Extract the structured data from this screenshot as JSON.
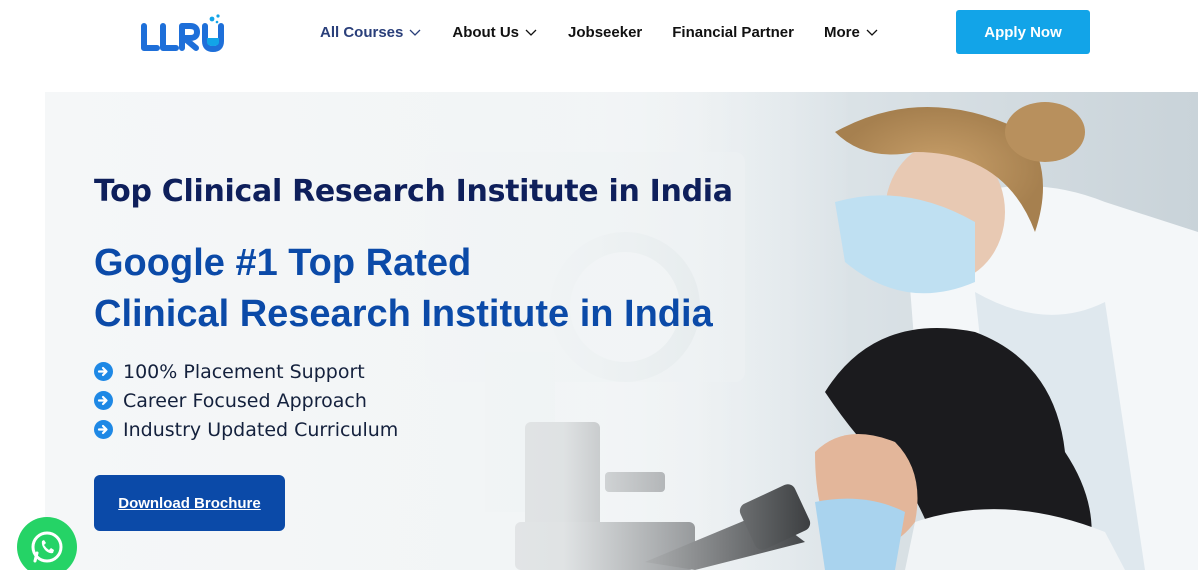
{
  "header": {
    "logo_text": "LLRU",
    "nav": [
      {
        "label": "All Courses",
        "has_dropdown": true,
        "active": true
      },
      {
        "label": "About Us",
        "has_dropdown": true,
        "active": false
      },
      {
        "label": "Jobseeker",
        "has_dropdown": false,
        "active": false
      },
      {
        "label": "Financial Partner",
        "has_dropdown": false,
        "active": false
      },
      {
        "label": "More",
        "has_dropdown": true,
        "active": false
      }
    ],
    "apply_label": "Apply Now"
  },
  "hero": {
    "subtitle": "Top Clinical Research Institute in India",
    "headline_line1": "Google #1 Top Rated",
    "headline_line2": "Clinical Research Institute in India",
    "features": [
      "100% Placement Support",
      "Career Focused Approach",
      "Industry Updated Curriculum"
    ],
    "brochure_label": "Download Brochure"
  },
  "floating": {
    "whatsapp_icon": "whatsapp-icon"
  },
  "colors": {
    "brand_blue": "#0b4aa8",
    "navy": "#0e1f5b",
    "accent_cyan": "#12a4e8",
    "logo_blue": "#1e6fd9",
    "whatsapp_green": "#25d366"
  }
}
